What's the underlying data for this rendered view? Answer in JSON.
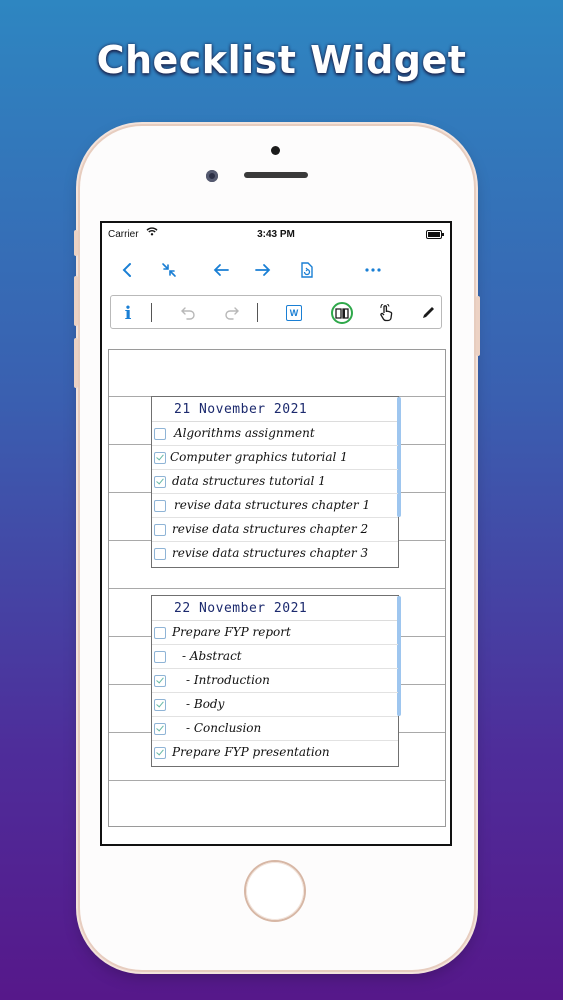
{
  "headline": "Checklist Widget",
  "status": {
    "carrier": "Carrier",
    "time": "3:43 PM"
  },
  "nav": [
    "back-icon",
    "collapse-icon",
    "arrow-left-icon",
    "arrow-right-icon",
    "document-refresh-icon",
    "more-icon"
  ],
  "toolbar": {
    "info_label": "i",
    "word_label": "W",
    "accent": "#1a7fd4",
    "active_ring": "#2ea84a"
  },
  "checklists": [
    {
      "title": "21 November 2021",
      "items": [
        {
          "text": "Algorithms assignment",
          "checked": false
        },
        {
          "text": "Computer graphics tutorial 1",
          "checked": true
        },
        {
          "text": "data structures tutorial 1",
          "checked": true
        },
        {
          "text": "revise data structures chapter 1",
          "checked": false
        },
        {
          "text": "revise data structures chapter 2",
          "checked": false
        },
        {
          "text": "revise data structures chapter 3",
          "checked": false
        }
      ]
    },
    {
      "title": "22 November 2021",
      "items": [
        {
          "text": "Prepare FYP report",
          "checked": false
        },
        {
          "text": "- Abstract",
          "checked": false
        },
        {
          "text": "- Introduction",
          "checked": true
        },
        {
          "text": "- Body",
          "checked": true
        },
        {
          "text": "- Conclusion",
          "checked": true
        },
        {
          "text": "Prepare FYP presentation",
          "checked": true
        }
      ]
    }
  ]
}
